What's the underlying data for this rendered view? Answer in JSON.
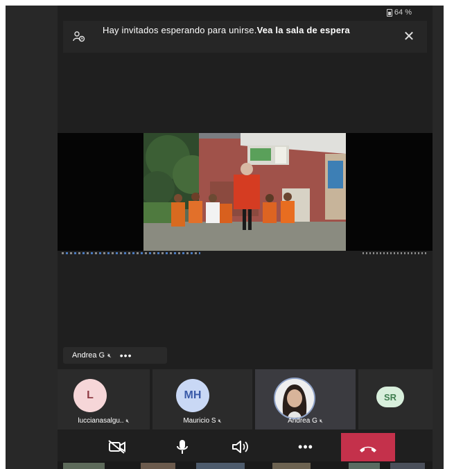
{
  "status": {
    "battery_text": "64 %"
  },
  "banner": {
    "message": "Hay invitados esperando para unirse.",
    "link": "Vea la sala de espera",
    "icon": "people-waiting-icon"
  },
  "main_speaker": {
    "name": "Andrea G"
  },
  "participants": [
    {
      "initials": "L",
      "name": "luccianasalgu..",
      "avatar_bg": "#f6d6d8",
      "avatar_fg": "#8e3b44"
    },
    {
      "initials": "MH",
      "name": "Mauricio S",
      "avatar_bg": "#c9d8f5",
      "avatar_fg": "#3a5aa8"
    },
    {
      "initials": "",
      "name": "Andrea G",
      "avatar_bg": "#f0f0f0",
      "avatar_fg": "#333333"
    },
    {
      "initials": "SR",
      "name": "",
      "avatar_bg": "#d8efdc",
      "avatar_fg": "#3f7d4f"
    }
  ],
  "controls": {
    "camera": "camera-off-icon",
    "mic": "microphone-icon",
    "speaker": "speaker-icon",
    "more": "more-icon",
    "hangup": "hang-up-icon"
  },
  "colors": {
    "hangup": "#c4314b",
    "background": "#1f1f1f"
  }
}
